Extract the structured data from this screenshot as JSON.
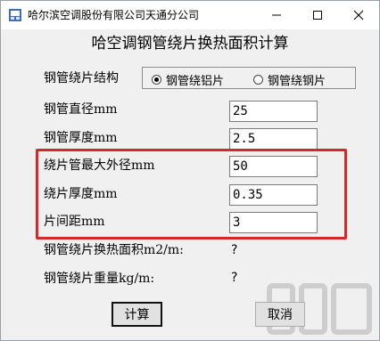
{
  "window": {
    "title": "哈尔滨空调股份有限公司天通分公司"
  },
  "heading": "哈空调钢管绕片换热面积计算",
  "structure": {
    "label": "钢管绕片结构",
    "options": [
      "钢管绕铝片",
      "钢管绕钢片"
    ],
    "selected": "钢管绕铝片"
  },
  "fields": {
    "pipe_diameter": {
      "label": "钢管直径mm",
      "value": "25"
    },
    "pipe_thickness": {
      "label": "钢管厚度mm",
      "value": "2.5"
    },
    "fin_outer_diameter": {
      "label": "绕片管最大外径mm",
      "value": "50"
    },
    "fin_thickness": {
      "label": "绕片厚度mm",
      "value": "0.35"
    },
    "fin_spacing": {
      "label": "片间距mm",
      "value": "3"
    }
  },
  "results": {
    "area": {
      "label": "钢管绕片换热面积m2/m:",
      "value": "?"
    },
    "weight": {
      "label": "钢管绕片重量kg/m:",
      "value": "?"
    }
  },
  "buttons": {
    "calculate": "计算",
    "cancel": "取消"
  },
  "colors": {
    "highlight": "#d22a2a"
  },
  "icons": {
    "app": "app-icon",
    "minimize": "minimize-icon",
    "maximize": "maximize-icon",
    "close": "close-icon"
  }
}
